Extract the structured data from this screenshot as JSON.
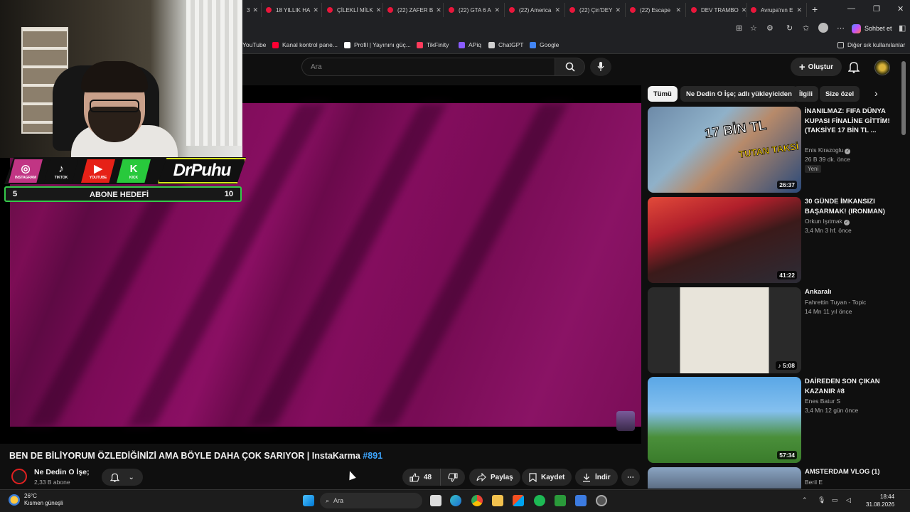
{
  "browser": {
    "tabs": [
      {
        "label": "3"
      },
      {
        "label": "18 YILLIK HA"
      },
      {
        "label": "ÇİLEKLİ MİLK"
      },
      {
        "label": "(22) ZAFER B"
      },
      {
        "label": "(22) GTA 6 A"
      },
      {
        "label": "(22) America"
      },
      {
        "label": "(22) Çin'DEY"
      },
      {
        "label": "(22) Escape"
      },
      {
        "label": "DEV TRAMBO"
      },
      {
        "label": "Avrupa'nın E"
      }
    ],
    "chat_label": "Sohbet et",
    "bookmarks": [
      {
        "label": "YouTube",
        "color": "#ff0033"
      },
      {
        "label": "Kanal kontrol pane...",
        "color": "#ff0033"
      },
      {
        "label": "Profil | Yayınını güç...",
        "color": "#ffffff"
      },
      {
        "label": "TikFinity",
        "color": "#ff3b5c"
      },
      {
        "label": "APiq",
        "color": "#8a5cff"
      },
      {
        "label": "ChatGPT",
        "color": "#d0d0d0"
      },
      {
        "label": "Google",
        "color": "#4285f4"
      }
    ],
    "other_bookmarks": "Diğer sık kullanılanlar"
  },
  "header": {
    "search_placeholder": "Ara",
    "create_label": "Oluştur"
  },
  "overlay": {
    "socials": [
      {
        "glyph": "◎",
        "label": "INSTAGRAM",
        "color": "#c13584"
      },
      {
        "glyph": "♪",
        "label": "TIKTOK",
        "color": "#111111"
      },
      {
        "glyph": "▶",
        "label": "YOUTUBE",
        "color": "#e62117"
      },
      {
        "glyph": "K",
        "label": "KICK",
        "color": "#28c93c"
      }
    ],
    "brand": "DrPuhu",
    "goal_label": "ABONE HEDEFİ",
    "goal_current": "5",
    "goal_target": "10"
  },
  "video": {
    "title": "BEN DE BİLİYORUM ÖZLEDİĞİNİZİ AMA BÖYLE DAHA ÇOK SARIYOR | InstaKarma",
    "hashtag": "#891",
    "channel": "Ne Dedin O İşe;",
    "subscribers": "2,33 B abone",
    "likes": "48",
    "share_label": "Paylaş",
    "save_label": "Kaydet",
    "download_label": "İndir"
  },
  "chips": [
    {
      "label": "Tümü",
      "active": true
    },
    {
      "label": "Ne Dedin O İşe; adlı yükleyiciden",
      "active": false
    },
    {
      "label": "İlgili",
      "active": false
    },
    {
      "label": "Size özel",
      "active": false
    }
  ],
  "recommendations": [
    {
      "title": "İNANILMAZ: FIFA DÜNYA KUPASI FİNALİNE GİTTİM! (TAKSİYE 17 BİN TL ...",
      "channel": "Enis Kirazoglu",
      "verified": true,
      "views": "26 B",
      "age": "39 dk. önce",
      "duration": "26:37",
      "badge": "Yeni"
    },
    {
      "title": "30 GÜNDE İMKANSIZI BAŞARMAK! (IRONMAN)",
      "channel": "Orkun Işıtmak",
      "verified": true,
      "views": "3,4 Mn",
      "age": "3 hf. önce",
      "duration": "41:22",
      "badge": ""
    },
    {
      "title": "Ankaralı",
      "channel": "Fahrettin Tuyan - Topic",
      "verified": false,
      "views": "14 Mn",
      "age": "11 yıl önce",
      "duration": "♪ 5:08",
      "badge": ""
    },
    {
      "title": "DAİREDEN SON ÇIKAN KAZANIR #8",
      "channel": "Enes Batur S",
      "verified": false,
      "views": "3,4 Mn",
      "age": "12 gün önce",
      "duration": "57:34",
      "badge": ""
    },
    {
      "title": "AMSTERDAM VLOG (1)",
      "channel": "Beril E",
      "verified": false,
      "views": "",
      "age": "",
      "duration": "",
      "badge": ""
    }
  ],
  "thumb_texts": {
    "taxi": "17 BİN TL",
    "taxi2": "TUTAN TAKSİ"
  },
  "taskbar": {
    "temperature": "26°C",
    "weather": "Kısmen güneşli",
    "search": "Ara",
    "time": "18:44",
    "date": "31.08.2026"
  },
  "colors": {
    "accent": "#3ea6ff",
    "yt_red": "#ff0033",
    "overlay_green": "#35c94a",
    "brand_yellow": "#d7e51a"
  }
}
